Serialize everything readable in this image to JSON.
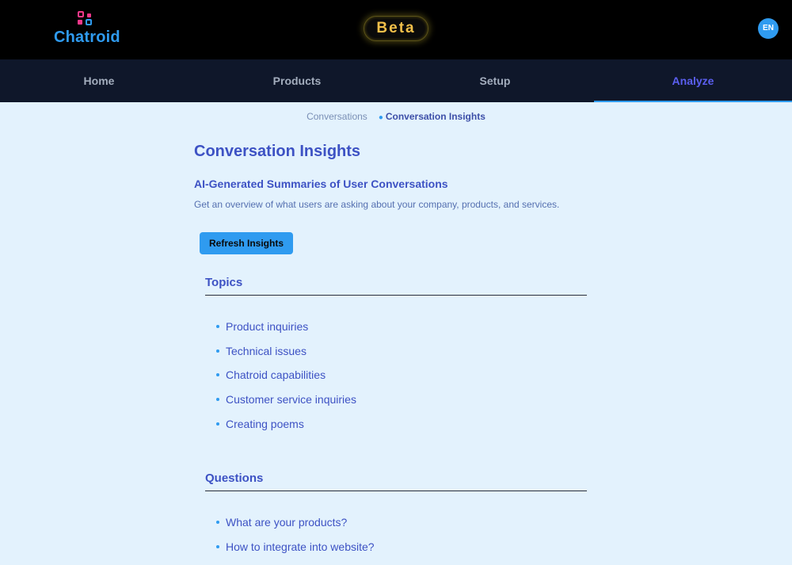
{
  "header": {
    "logo_text": "Chatroid",
    "badge": "Beta",
    "language": "EN"
  },
  "nav": {
    "items": [
      {
        "label": "Home",
        "active": false
      },
      {
        "label": "Products",
        "active": false
      },
      {
        "label": "Setup",
        "active": false
      },
      {
        "label": "Analyze",
        "active": true
      }
    ]
  },
  "breadcrumb": {
    "parent": "Conversations",
    "current": "Conversation Insights"
  },
  "main": {
    "title": "Conversation Insights",
    "subtitle": "AI-Generated Summaries of User Conversations",
    "description": "Get an overview of what users are asking about your company, products, and services.",
    "refresh_label": "Refresh Insights"
  },
  "topics": {
    "heading": "Topics",
    "items": [
      "Product inquiries",
      "Technical issues",
      "Chatroid capabilities",
      "Customer service inquiries",
      "Creating poems"
    ]
  },
  "questions": {
    "heading": "Questions",
    "items": [
      "What are your products?",
      "How to integrate into website?"
    ]
  },
  "colors": {
    "accent": "#2f9bf0",
    "brand_pink": "#f0388a",
    "heading": "#3d52c4",
    "nav_active": "#5b5ff0"
  }
}
